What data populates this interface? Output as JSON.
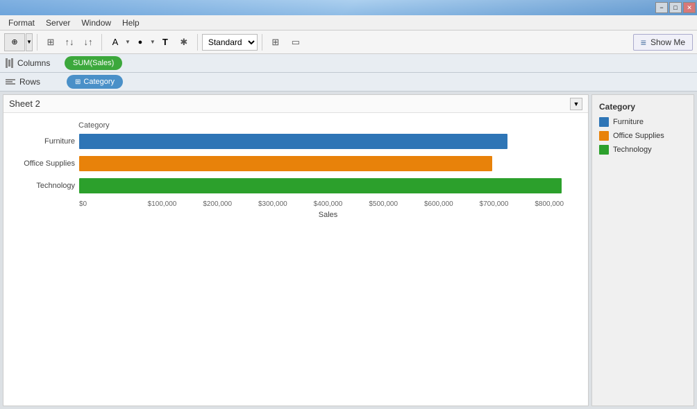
{
  "titlebar": {
    "controls": {
      "minimize": "−",
      "maximize": "□",
      "close": "✕"
    }
  },
  "menu": {
    "items": [
      "Format",
      "Server",
      "Window",
      "Help"
    ]
  },
  "toolbar": {
    "dropdown_label": "Standard",
    "show_me_label": "Show Me",
    "show_me_icon": "≡"
  },
  "shelves": {
    "columns_label": "Columns",
    "columns_pill": "SUM(Sales)",
    "rows_label": "Rows",
    "rows_pill": "Category"
  },
  "sheet": {
    "title": "Sheet 2",
    "dropdown_icon": "▼"
  },
  "chart": {
    "y_axis_label": "Category",
    "x_axis_label": "Sales",
    "x_ticks": [
      "$0",
      "$100,000",
      "$200,000",
      "$300,000",
      "$400,000",
      "$500,000",
      "$600,000",
      "$700,000",
      "$800,000"
    ],
    "bars": [
      {
        "label": "Furniture",
        "color": "#2e75b6",
        "value": 742000,
        "max": 860000,
        "pct": 86
      },
      {
        "label": "Office Supplies",
        "color": "#e8820a",
        "value": 719000,
        "max": 860000,
        "pct": 83
      },
      {
        "label": "Technology",
        "color": "#2ca02c",
        "value": 835000,
        "max": 860000,
        "pct": 97
      }
    ]
  },
  "legend": {
    "title": "Category",
    "items": [
      {
        "label": "Furniture",
        "color": "#2e75b6"
      },
      {
        "label": "Office Supplies",
        "color": "#e8820a"
      },
      {
        "label": "Technology",
        "color": "#2ca02c"
      }
    ]
  }
}
